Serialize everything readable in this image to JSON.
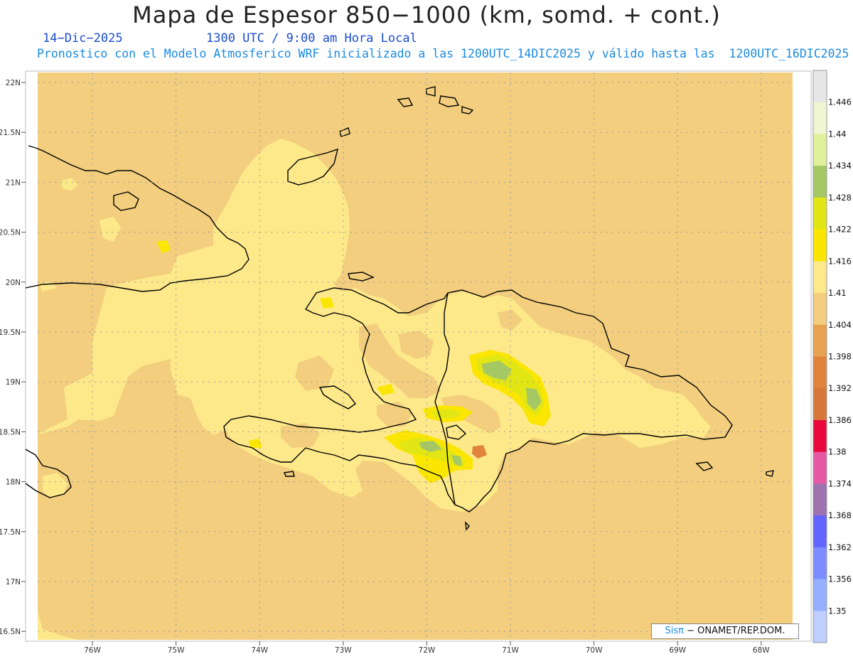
{
  "header": {
    "title": "Mapa de Espesor 850−1000 (km, somd. + cont.)",
    "date": "14−Dic−2025",
    "time": "1300 UTC / 9:00 am Hora Local",
    "model_line": "Pronostico con el Modelo Atmosferico WRF inicializado a las 1200UTC_14DIC2025 y válido hasta las  1200UTC_16DIC2025"
  },
  "axes": {
    "lat_labels": [
      "22N",
      "21.5N",
      "21N",
      "20.5N",
      "20N",
      "19.5N",
      "19N",
      "18.5N",
      "18N",
      "17.5N",
      "17N",
      "16.5N"
    ],
    "lon_labels": [
      "76W",
      "75W",
      "74W",
      "73W",
      "72W",
      "71W",
      "70W",
      "69W",
      "68W"
    ]
  },
  "colorbar": {
    "labels": [
      "1.446",
      "1.44",
      "1.434",
      "1.428",
      "1.422",
      "1.416",
      "1.41",
      "1.404",
      "1.398",
      "1.392",
      "1.386",
      "1.38",
      "1.374",
      "1.368",
      "1.362",
      "1.356",
      "1.35"
    ],
    "colors": [
      "#e6e6e6",
      "#f0f5d2",
      "#e1f09b",
      "#a5c864",
      "#e1e614",
      "#fae600",
      "#fde98a",
      "#f2ce7e",
      "#e8a24f",
      "#e0843c",
      "#d7783a",
      "#e8083c",
      "#e65aa5",
      "#9d73af",
      "#6464ff",
      "#7d8cff",
      "#96afff",
      "#beceff"
    ]
  },
  "colors": {
    "background_field": "#f2ce7e",
    "field_1410": "#fde98a",
    "field_1416": "#fae600",
    "field_1422": "#e1e614",
    "field_1428": "#a5c864",
    "field_1398": "#e0843c",
    "coast": "#000000"
  },
  "credit": {
    "logo": "Sisπ",
    "text": "− ONAMET/REP.DOM."
  }
}
